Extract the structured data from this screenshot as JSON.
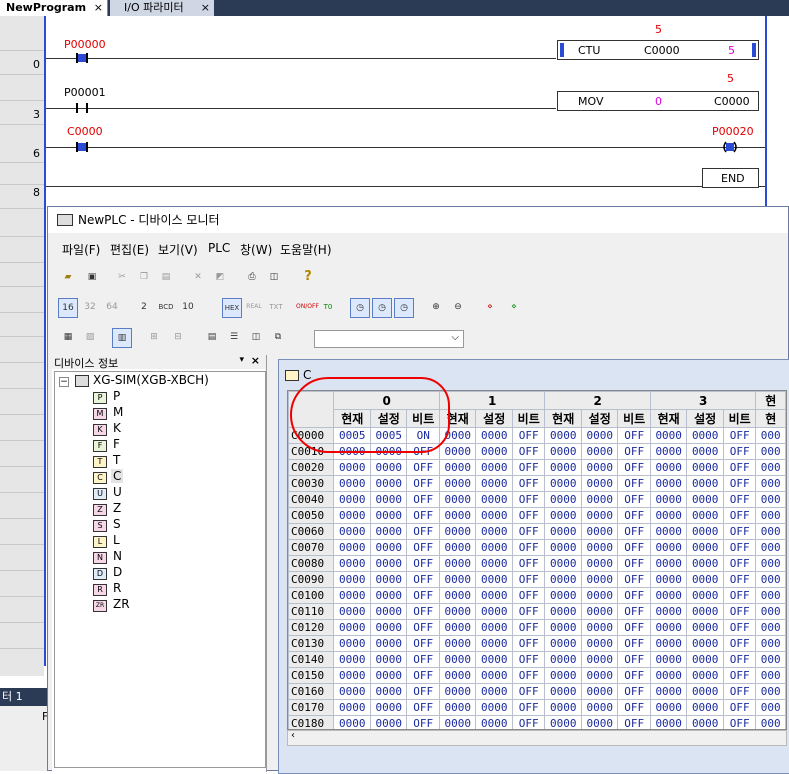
{
  "tabs": [
    {
      "label": "NewProgram",
      "close": "×"
    },
    {
      "label": "I/O 파라미터",
      "close": "×"
    }
  ],
  "ladder": {
    "rows": [
      {
        "num": "0",
        "contact": "P00000",
        "func": "CTU",
        "operand": "C0000",
        "value": "5",
        "top_value": "5"
      },
      {
        "num": "3",
        "contact": "P00001",
        "func": "MOV",
        "src": "0",
        "dest": "C0000",
        "top_value": "5"
      },
      {
        "num": "6",
        "contact": "C0000",
        "coil": "P00020"
      },
      {
        "num": "8",
        "end": "END"
      }
    ]
  },
  "bottom_panel": {
    "title": "터 1",
    "col": "F"
  },
  "monitor": {
    "title": "NewPLC - 디바이스 모니터",
    "menu": [
      "파일(F)",
      "편집(E)",
      "보기(V)",
      "PLC",
      "창(W)",
      "도움말(H)"
    ],
    "toolbar_icons": [
      "open-icon",
      "save-icon",
      "cut-icon",
      "copy-icon",
      "paste-icon",
      "delete-icon",
      "erase-icon",
      "print-icon",
      "print-preview-icon",
      "help-icon"
    ],
    "format_buttons": [
      "16",
      "32",
      "64",
      "2",
      "BCD",
      "10",
      "HEX",
      "REAL",
      "TXT",
      "ON/OFF",
      "T0"
    ],
    "combo_value": "",
    "tree": {
      "header": "디바이스 정보",
      "root": "XG-SIM(XGB-XBCH)",
      "items": [
        "P",
        "M",
        "K",
        "F",
        "T",
        "C",
        "U",
        "Z",
        "S",
        "L",
        "N",
        "D",
        "R",
        "ZR"
      ],
      "selected": "C"
    },
    "device_window": {
      "title": "C",
      "groups": [
        "0",
        "1",
        "2",
        "3",
        "현"
      ],
      "subheaders": [
        "현재",
        "설정",
        "비트"
      ],
      "rows": [
        {
          "addr": "C0000",
          "cells": [
            "0005",
            "0005",
            "ON",
            "0000",
            "0000",
            "OFF",
            "0000",
            "0000",
            "OFF",
            "0000",
            "0000",
            "OFF",
            "000"
          ]
        },
        {
          "addr": "C0010",
          "cells": [
            "0000",
            "0000",
            "OFF",
            "0000",
            "0000",
            "OFF",
            "0000",
            "0000",
            "OFF",
            "0000",
            "0000",
            "OFF",
            "000"
          ]
        },
        {
          "addr": "C0020",
          "cells": [
            "0000",
            "0000",
            "OFF",
            "0000",
            "0000",
            "OFF",
            "0000",
            "0000",
            "OFF",
            "0000",
            "0000",
            "OFF",
            "000"
          ]
        },
        {
          "addr": "C0030",
          "cells": [
            "0000",
            "0000",
            "OFF",
            "0000",
            "0000",
            "OFF",
            "0000",
            "0000",
            "OFF",
            "0000",
            "0000",
            "OFF",
            "000"
          ]
        },
        {
          "addr": "C0040",
          "cells": [
            "0000",
            "0000",
            "OFF",
            "0000",
            "0000",
            "OFF",
            "0000",
            "0000",
            "OFF",
            "0000",
            "0000",
            "OFF",
            "000"
          ]
        },
        {
          "addr": "C0050",
          "cells": [
            "0000",
            "0000",
            "OFF",
            "0000",
            "0000",
            "OFF",
            "0000",
            "0000",
            "OFF",
            "0000",
            "0000",
            "OFF",
            "000"
          ]
        },
        {
          "addr": "C0060",
          "cells": [
            "0000",
            "0000",
            "OFF",
            "0000",
            "0000",
            "OFF",
            "0000",
            "0000",
            "OFF",
            "0000",
            "0000",
            "OFF",
            "000"
          ]
        },
        {
          "addr": "C0070",
          "cells": [
            "0000",
            "0000",
            "OFF",
            "0000",
            "0000",
            "OFF",
            "0000",
            "0000",
            "OFF",
            "0000",
            "0000",
            "OFF",
            "000"
          ]
        },
        {
          "addr": "C0080",
          "cells": [
            "0000",
            "0000",
            "OFF",
            "0000",
            "0000",
            "OFF",
            "0000",
            "0000",
            "OFF",
            "0000",
            "0000",
            "OFF",
            "000"
          ]
        },
        {
          "addr": "C0090",
          "cells": [
            "0000",
            "0000",
            "OFF",
            "0000",
            "0000",
            "OFF",
            "0000",
            "0000",
            "OFF",
            "0000",
            "0000",
            "OFF",
            "000"
          ]
        },
        {
          "addr": "C0100",
          "cells": [
            "0000",
            "0000",
            "OFF",
            "0000",
            "0000",
            "OFF",
            "0000",
            "0000",
            "OFF",
            "0000",
            "0000",
            "OFF",
            "000"
          ]
        },
        {
          "addr": "C0110",
          "cells": [
            "0000",
            "0000",
            "OFF",
            "0000",
            "0000",
            "OFF",
            "0000",
            "0000",
            "OFF",
            "0000",
            "0000",
            "OFF",
            "000"
          ]
        },
        {
          "addr": "C0120",
          "cells": [
            "0000",
            "0000",
            "OFF",
            "0000",
            "0000",
            "OFF",
            "0000",
            "0000",
            "OFF",
            "0000",
            "0000",
            "OFF",
            "000"
          ]
        },
        {
          "addr": "C0130",
          "cells": [
            "0000",
            "0000",
            "OFF",
            "0000",
            "0000",
            "OFF",
            "0000",
            "0000",
            "OFF",
            "0000",
            "0000",
            "OFF",
            "000"
          ]
        },
        {
          "addr": "C0140",
          "cells": [
            "0000",
            "0000",
            "OFF",
            "0000",
            "0000",
            "OFF",
            "0000",
            "0000",
            "OFF",
            "0000",
            "0000",
            "OFF",
            "000"
          ]
        },
        {
          "addr": "C0150",
          "cells": [
            "0000",
            "0000",
            "OFF",
            "0000",
            "0000",
            "OFF",
            "0000",
            "0000",
            "OFF",
            "0000",
            "0000",
            "OFF",
            "000"
          ]
        },
        {
          "addr": "C0160",
          "cells": [
            "0000",
            "0000",
            "OFF",
            "0000",
            "0000",
            "OFF",
            "0000",
            "0000",
            "OFF",
            "0000",
            "0000",
            "OFF",
            "000"
          ]
        },
        {
          "addr": "C0170",
          "cells": [
            "0000",
            "0000",
            "OFF",
            "0000",
            "0000",
            "OFF",
            "0000",
            "0000",
            "OFF",
            "0000",
            "0000",
            "OFF",
            "000"
          ]
        },
        {
          "addr": "C0180",
          "cells": [
            "0000",
            "0000",
            "OFF",
            "0000",
            "0000",
            "OFF",
            "0000",
            "0000",
            "OFF",
            "0000",
            "0000",
            "OFF",
            "000"
          ]
        }
      ]
    }
  },
  "colors": {
    "rail": "#2b4ad6",
    "active_label": "#e00000",
    "value_magenta": "#e000e0",
    "cell_value": "#1a2aa0",
    "annotation": "#e00000"
  }
}
